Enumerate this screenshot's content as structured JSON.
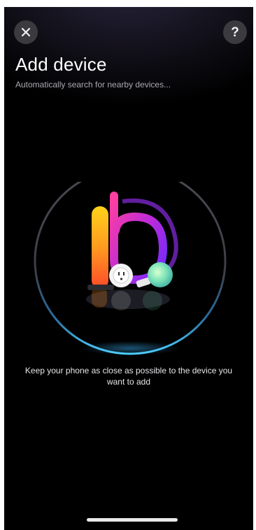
{
  "header": {
    "close_icon": "close-icon",
    "help_label": "?",
    "help_icon": "help-icon"
  },
  "title": "Add device",
  "subtitle": "Automatically search for nearby devices...",
  "illustration": {
    "icon": "smart-devices-illustration",
    "ring_accent": "#3fb8ff",
    "ring_color": "#4a4a52"
  },
  "hint": "Keep your phone as close as possible to the device you want to add"
}
